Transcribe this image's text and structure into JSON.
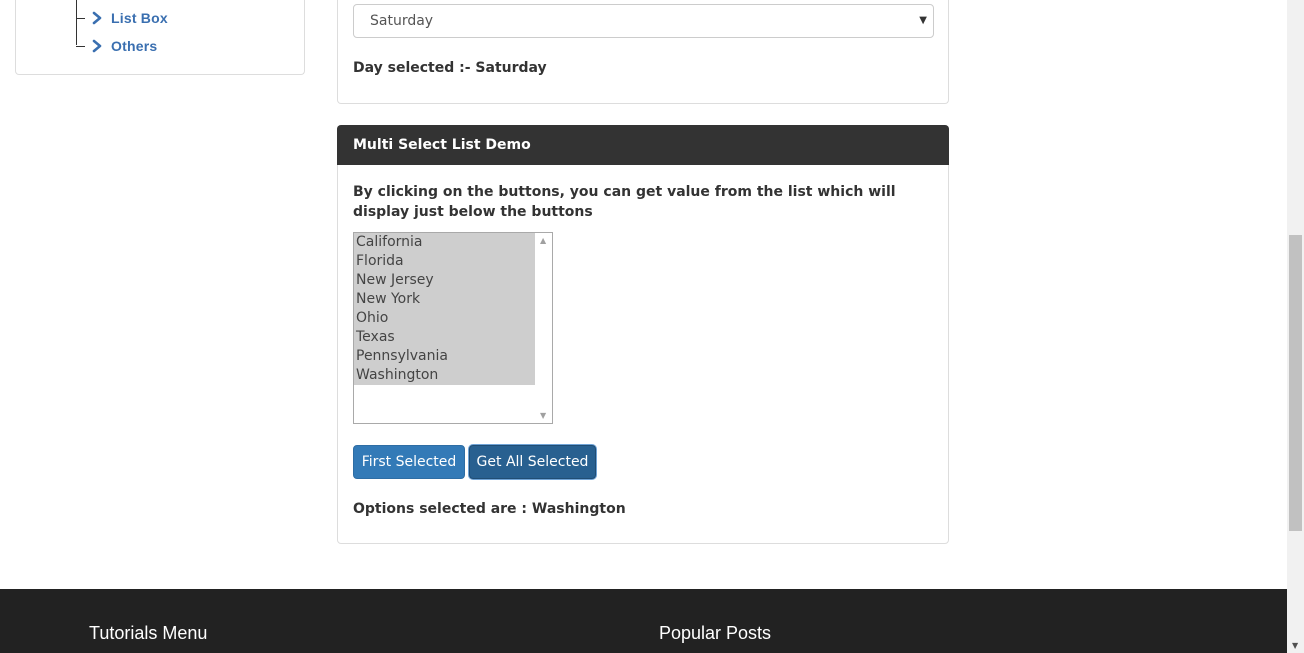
{
  "sidebar": {
    "items": [
      {
        "label": "List Box"
      },
      {
        "label": "Others"
      }
    ]
  },
  "single_select": {
    "selected_value": "Saturday",
    "result_text": "Day selected :- Saturday"
  },
  "multi_select": {
    "heading": "Multi Select List Demo",
    "description": "By clicking on the buttons, you can get value from the list which will display just below the buttons",
    "options": [
      "California",
      "Florida",
      "New Jersey",
      "New York",
      "Ohio",
      "Texas",
      "Pennsylvania",
      "Washington"
    ],
    "first_button_label": "First Selected",
    "all_button_label": "Get All Selected",
    "result_text": "Options selected are : Washington"
  },
  "footer": {
    "col1_title": "Tutorials Menu",
    "col2_title": "Popular Posts"
  },
  "colors": {
    "link": "#3a6fb0",
    "button_primary": "#337ab7",
    "button_active": "#286090",
    "panel_heading": "#333333",
    "footer_bg": "#222222"
  }
}
